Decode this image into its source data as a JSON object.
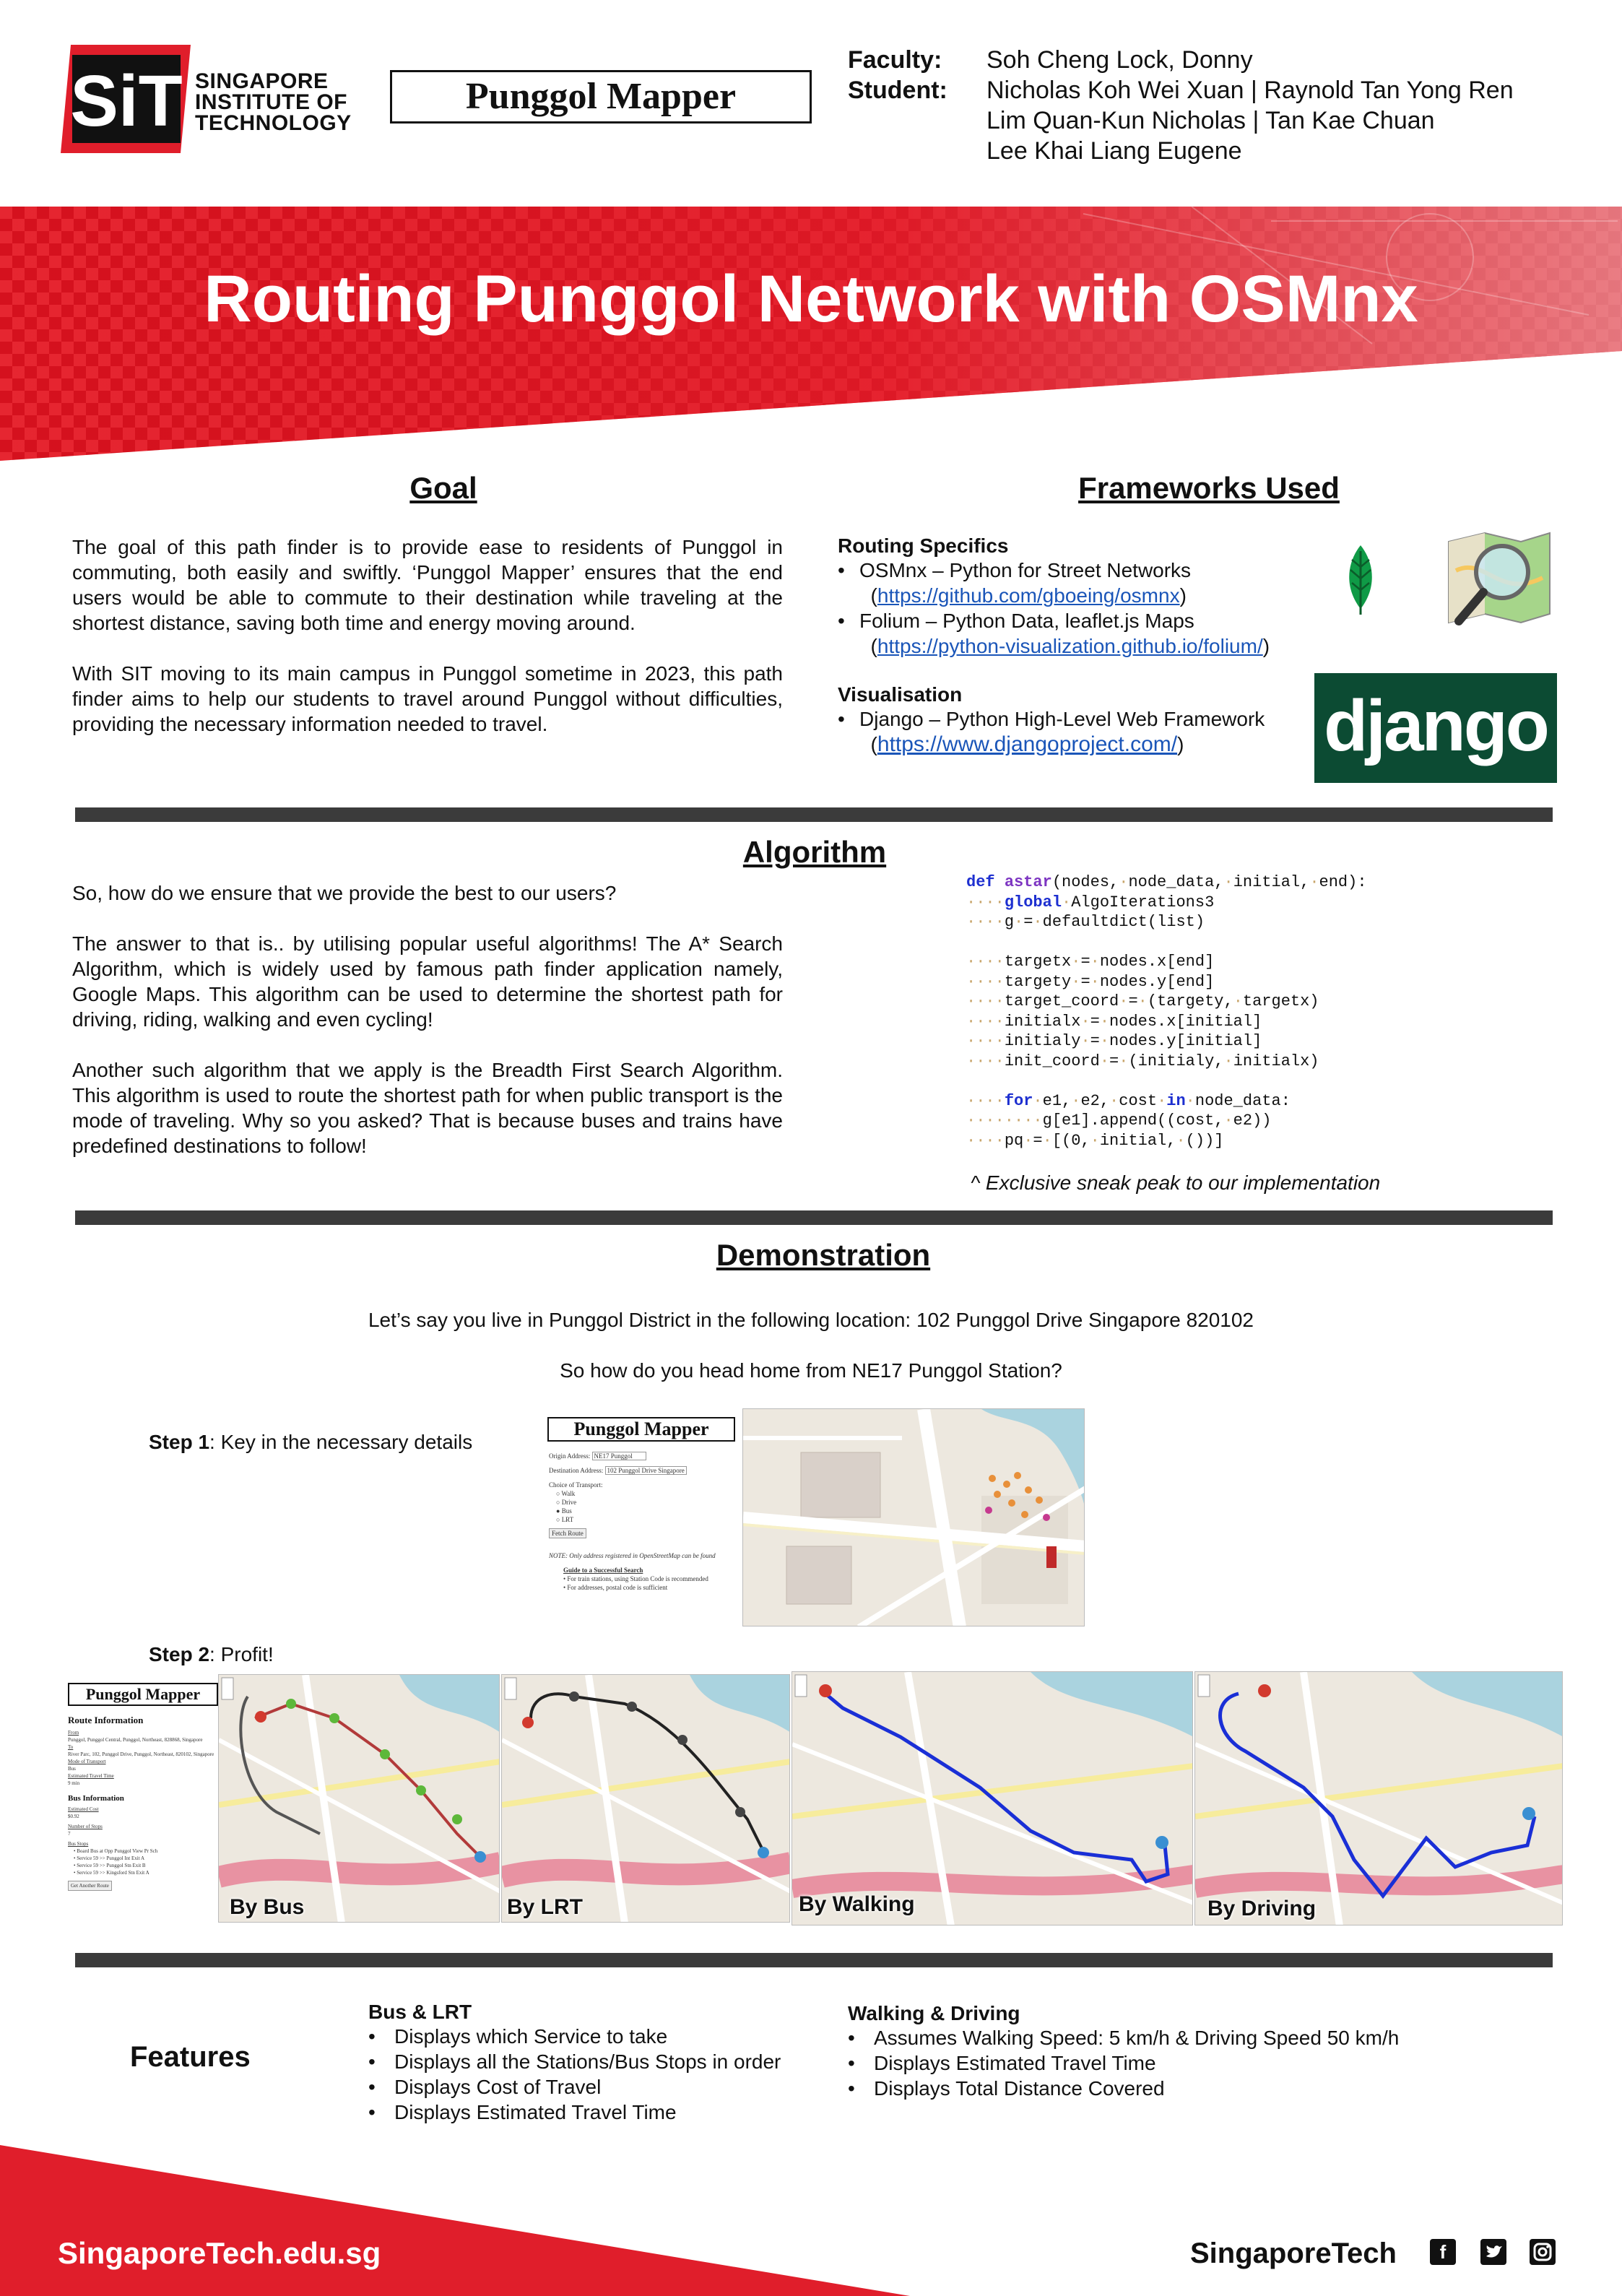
{
  "header": {
    "logo_mark": "SiT",
    "logo_words": [
      "SINGAPORE",
      "INSTITUTE OF",
      "TECHNOLOGY"
    ],
    "app_title": "Punggol Mapper",
    "faculty_label": "Faculty:",
    "faculty_name": "Soh Cheng Lock, Donny",
    "student_label": "Student:",
    "student_lines": [
      "Nicholas Koh Wei Xuan | Raynold Tan Yong Ren",
      "Lim Quan-Kun Nicholas | Tan Kae Chuan",
      "Lee Khai Liang Eugene"
    ]
  },
  "banner": {
    "title": "Routing Punggol Network with OSMnx",
    "color": "#e01e2b"
  },
  "goal": {
    "heading": "Goal",
    "paragraphs": [
      "The goal of this path finder is to provide ease to residents of Punggol in commuting, both easily and swiftly. ‘Punggol Mapper’ ensures that the end users would be able to commute to their destination while traveling at the shortest distance, saving both time and energy moving around.",
      "With SIT moving to its main campus in Punggol sometime in 2023, this path finder aims to help our students to travel around Punggol without difficulties, providing the necessary information needed to travel."
    ]
  },
  "frameworks": {
    "heading": "Frameworks Used",
    "routing_title": "Routing Specifics",
    "routing_items": [
      {
        "text": "OSMnx – Python for Street Networks",
        "link": "https://github.com/gboeing/osmnx"
      },
      {
        "text": "Folium – Python Data, leaflet.js Maps",
        "link": "https://python-visualization.github.io/folium/"
      }
    ],
    "vis_title": "Visualisation",
    "vis_items": [
      {
        "text": "Django – Python High-Level Web Framework",
        "link": "https://www.djangoproject.com/"
      }
    ],
    "django_logo": "django",
    "django_color": "#0c4b33"
  },
  "algorithm": {
    "heading": "Algorithm",
    "paragraphs": [
      "So, how do we ensure that we provide the best to our users?",
      "The answer to that is.. by utilising popular useful algorithms! The A* Search Algorithm, which is widely used by famous path finder application namely, Google Maps. This algorithm can be used to determine the shortest path for driving, riding, walking and even cycling!",
      "Another such algorithm that we apply is the Breadth First Search Algorithm. This algorithm is used to route the shortest path for when public transport is the mode of traveling. Why so you asked? That is because buses and trains have predefined destinations to follow!"
    ],
    "code_caption": "^ Exclusive sneak peak to our implementation"
  },
  "demo": {
    "heading": "Demonstration",
    "line1": "Let’s say you live in Punggol District in the following location: 102 Punggol Drive Singapore 820102",
    "line2": "So how do you head home from NE17 Punggol Station?",
    "step1_label": "Step 1",
    "step1_text": ": Key in the necessary details",
    "step2_label": "Step 2",
    "step2_text": ": Profit!",
    "form": {
      "title": "Punggol Mapper",
      "origin_label": "Origin Address:",
      "origin_value": "NE17 Punggol",
      "dest_label": "Destination Address:",
      "dest_value": "102 Punggol Drive Singapore",
      "transport_label": "Choice of Transport:",
      "options": [
        "Walk",
        "Drive",
        "Bus",
        "LRT"
      ],
      "button": "Fetch Route",
      "note": "NOTE: Only address registered in OpenStreetMap can be found",
      "guide_title": "Guide to a Successful Search",
      "guide_items": [
        "For train stations, using Station Code is recommended",
        "For addresses, postal code is sufficient"
      ]
    },
    "route_panel": {
      "title": "Punggol Mapper",
      "heading": "Route Information",
      "lines": [
        "From",
        "Punggol, Punggol Central, Punggol, Northeast, 828868, Singapore",
        "To",
        "River Parc, 102, Punggol Drive, Punggol, Northeast, 820102, Singapore",
        "Mode of Transport",
        "Bus",
        "Estimated Travel Time",
        "9 min"
      ],
      "bus_heading": "Bus Information",
      "bus_lines": [
        "Estimated Cost",
        "$0.92",
        "Number of Stops",
        "7",
        "Bus Stops"
      ],
      "bus_stops": [
        "Board Bus at Opp Punggol View Pr Sch",
        "Service 59 >> Punggol Int Exit A",
        "Service 59 >> Punggol Stn Exit B",
        "Service 59 >> Kingsford Stn Exit A"
      ],
      "button": "Get Another Route"
    },
    "captions": [
      "By Bus",
      "By LRT",
      "By Walking",
      "By Driving"
    ]
  },
  "features": {
    "label": "Features",
    "col1_title": "Bus & LRT",
    "col1_items": [
      "Displays which Service to take",
      "Displays all the Stations/Bus Stops in order",
      "Displays Cost of Travel",
      "Displays Estimated Travel Time"
    ],
    "col2_title": "Walking & Driving",
    "col2_items": [
      "Assumes Walking Speed: 5 km/h & Driving Speed 50 km/h",
      "Displays Estimated Travel Time",
      "Displays Total Distance Covered"
    ]
  },
  "footer": {
    "website": "SingaporeTech.edu.sg",
    "brand": "SingaporeTech",
    "icons": [
      "facebook-icon",
      "twitter-icon",
      "instagram-icon"
    ]
  }
}
